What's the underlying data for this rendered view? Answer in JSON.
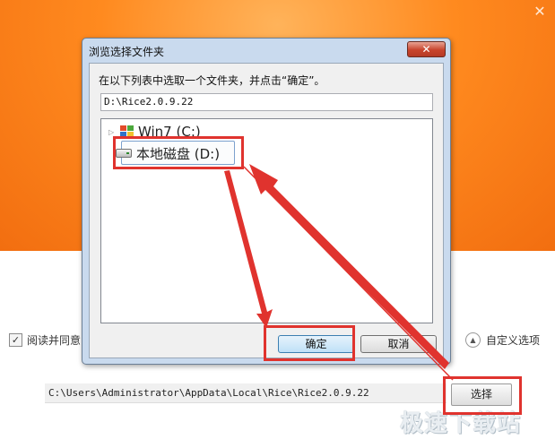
{
  "installer": {
    "agree_label": "阅读并同意",
    "check_mark": "✓",
    "custom_options_label": "自定义选项",
    "install_path": "C:\\Users\\Administrator\\AppData\\Local\\Rice\\Rice2.0.9.22",
    "choose_label": "选择",
    "close_glyph": "✕",
    "watermark": "极速下载站"
  },
  "dialog": {
    "title": "浏览选择文件夹",
    "instruction": "在以下列表中选取一个文件夹，并点击“确定”。",
    "path_value": "D:\\Rice2.0.9.22",
    "tree": [
      {
        "label": "Win7 (C:)",
        "icon": "windows-drive-icon"
      },
      {
        "label": "本地磁盘 (D:)",
        "icon": "hard-disk-icon",
        "selected": true
      }
    ],
    "ok_label": "确定",
    "cancel_label": "取消",
    "close_glyph": "✕"
  },
  "colors": {
    "header_orange": "#f26e10",
    "annotation_red": "#e0332e",
    "dialog_frame": "#c9daee"
  }
}
